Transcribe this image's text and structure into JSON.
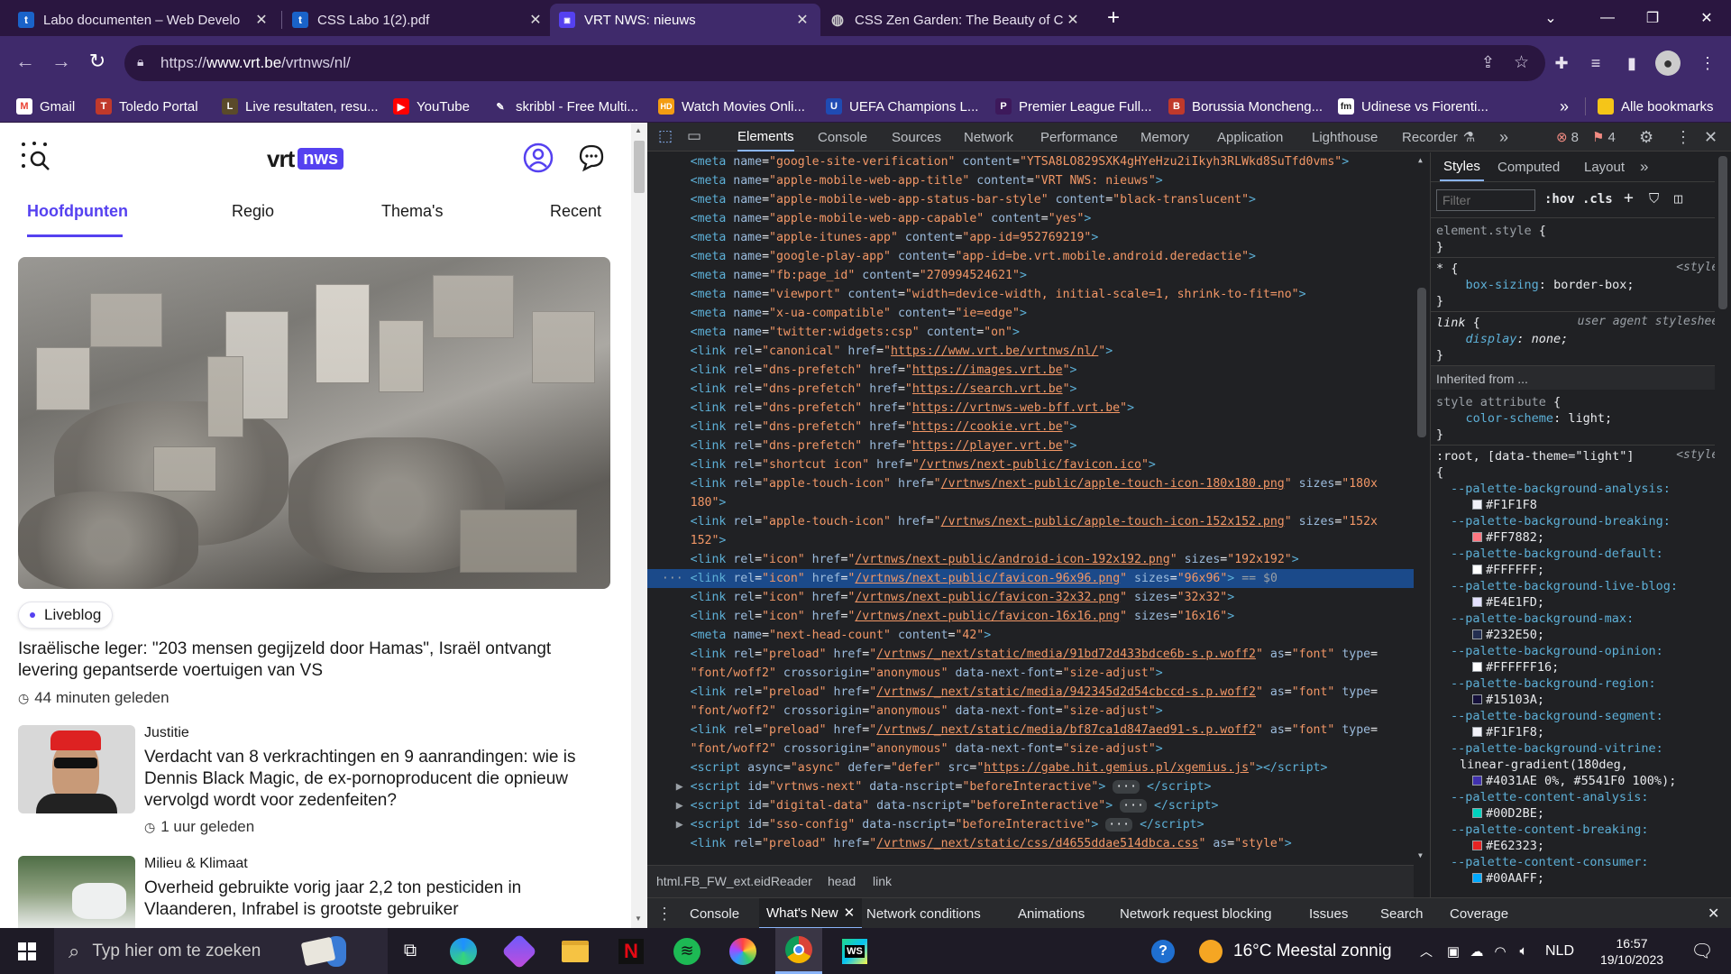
{
  "browser": {
    "tabs": [
      {
        "title": "Labo documenten – Web Develo",
        "favicon": "t",
        "fav_color": "#1a63c9"
      },
      {
        "title": "CSS Labo 1(2).pdf",
        "favicon": "t",
        "fav_color": "#1a63c9"
      },
      {
        "title": "VRT NWS: nieuws",
        "favicon": "nws",
        "fav_color": "#5541f0"
      },
      {
        "title": "CSS Zen Garden: The Beauty of C",
        "favicon": "globe-icon",
        "fav_color": "#777"
      }
    ],
    "new_tab": "+",
    "url_prefix": "https://",
    "url_host": "www.vrt.be",
    "url_path": "/vrtnws/nl/",
    "bookmarks": [
      {
        "label": "Gmail",
        "icon": "M",
        "color": "#ea4335"
      },
      {
        "label": "Toledo Portal",
        "icon": "T",
        "color": "#c0392b"
      },
      {
        "label": "Live resultaten, resu...",
        "icon": "L",
        "color": "#5a4a2a"
      },
      {
        "label": "YouTube",
        "icon": "▶",
        "color": "#ff0000"
      },
      {
        "label": "skribbl - Free Multi...",
        "icon": "✎",
        "color": "#3f2a6b"
      },
      {
        "label": "Watch Movies Onli...",
        "icon": "HD",
        "color": "#f39c12"
      },
      {
        "label": "UEFA Champions L...",
        "icon": "U",
        "color": "#1f4bb3"
      },
      {
        "label": "Premier League Full...",
        "icon": "P",
        "color": "#3d195b"
      },
      {
        "label": "Borussia Moncheng...",
        "icon": "B",
        "color": "#c0392b"
      },
      {
        "label": "Udinese vs Fiorenti...",
        "icon": "fm",
        "color": "#2a1640"
      }
    ],
    "bookmarks_more": "»",
    "all_bookmarks": "Alle bookmarks"
  },
  "page": {
    "logo_vrt": "vrt",
    "logo_nws": "nws",
    "nav": [
      "Hoofdpunten",
      "Regio",
      "Thema's",
      "Recent"
    ],
    "liveblog_label": "Liveblog",
    "hero_headline": "Israëlische leger: \"203 mensen gegijzeld door Hamas\", Israël ontvangt levering gepantserde voertuigen van VS",
    "hero_time": "44 minuten geleden",
    "articles": [
      {
        "category": "Justitie",
        "headline": "Verdacht van 8 verkrachtingen en 9 aanrandingen: wie is Dennis Black Magic, de ex-pornoproducent die opnieuw vervolgd wordt voor zedenfeiten?",
        "time": "1 uur geleden"
      },
      {
        "category": "Milieu & Klimaat",
        "headline": "Overheid gebruikte vorig jaar 2,2 ton pesticiden in Vlaanderen, Infrabel is grootste gebruiker",
        "time": ""
      }
    ]
  },
  "devtools": {
    "tabs": [
      "Elements",
      "Console",
      "Sources",
      "Network",
      "Performance",
      "Memory",
      "Application",
      "Lighthouse",
      "Recorder"
    ],
    "more": "»",
    "errors": "8",
    "warnings": "4",
    "breadcrumbs": [
      "html.FB_FW_ext.eidReader",
      "head",
      "link"
    ],
    "style_tabs": [
      "Styles",
      "Computed",
      "Layout"
    ],
    "filter_placeholder": "Filter",
    "hov": ":hov",
    "cls": ".cls",
    "inherited": "Inherited from ...",
    "drawer_tabs": [
      "Console",
      "What's New",
      "Network conditions",
      "Animations",
      "Network request blocking",
      "Issues",
      "Search",
      "Coverage"
    ],
    "palette": [
      {
        "name": "--palette-background-analysis:",
        "value": "#F1F1F8",
        "swatch": "#F1F1F8"
      },
      {
        "name": "--palette-background-breaking:",
        "value": "#FF7882;",
        "swatch": "#FF7882"
      },
      {
        "name": "--palette-background-default:",
        "value": "#FFFFFF;",
        "swatch": "#FFFFFF"
      },
      {
        "name": "--palette-background-live-blog:",
        "value": "#E4E1FD;",
        "swatch": "#E4E1FD"
      },
      {
        "name": "--palette-background-max:",
        "value": "#232E50;",
        "swatch": "#232E50"
      },
      {
        "name": "--palette-background-opinion:",
        "value": "#FFFFFF16;",
        "swatch": "#FFFFFF"
      },
      {
        "name": "--palette-background-region:",
        "value": "#15103A;",
        "swatch": "#15103A"
      },
      {
        "name": "--palette-background-segment:",
        "value": "#F1F1F8;",
        "swatch": "#F1F1F8"
      },
      {
        "name": "--palette-background-vitrine:",
        "value": "linear-gradient(180deg,",
        "swatch": ""
      },
      {
        "name": "--palette-content-analysis:",
        "value": "#00D2BE;",
        "swatch": "#00D2BE"
      },
      {
        "name": "--palette-content-breaking:",
        "value": "#E62323;",
        "swatch": "#E62323"
      },
      {
        "name": "--palette-content-consumer:",
        "value": "#00AAFF;",
        "swatch": "#00AAFF"
      }
    ],
    "vitrine_line2": "#4031AE 0%, #5541F0 100%);"
  },
  "taskbar": {
    "search_placeholder": "Typ hier om te zoeken",
    "weather": "16°C  Meestal zonnig",
    "language": "NLD",
    "time": "16:57",
    "date": "19/10/2023"
  }
}
